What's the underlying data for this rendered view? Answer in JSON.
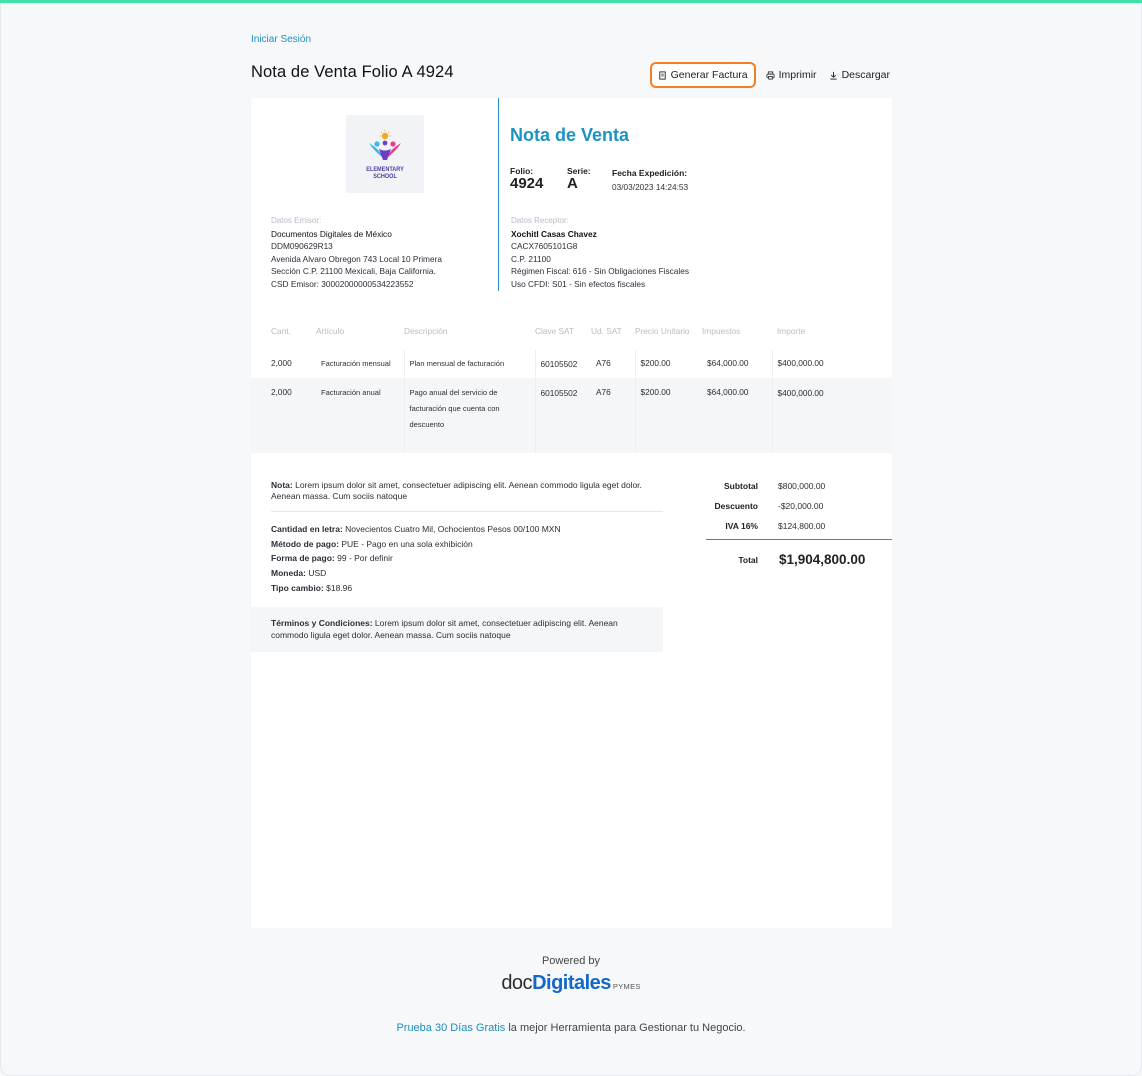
{
  "header": {
    "login_link": "Iniciar Sesión",
    "page_title": "Nota de Venta Folio A 4924",
    "actions": {
      "generate": "Generar Factura",
      "print": "Imprimir",
      "download": "Descargar"
    }
  },
  "document": {
    "logo_text_1": "ELEMENTARY",
    "logo_text_2": "SCHOOL",
    "heading": "Nota de Venta",
    "folio_label": "Folio:",
    "folio_value": "4924",
    "serie_label": "Serie:",
    "serie_value": "A",
    "fecha_label": "Fecha Expedición:",
    "fecha_value": "03/03/2023 14:24:53",
    "emisor": {
      "label": "Datos Emisor:",
      "name": "Documentos Digitales de México",
      "rfc": "DDM090629R13",
      "address_1": "Avenida Alvaro Obregon 743 Local 10 Primera",
      "address_2": "Sección C.P. 21100 Mexicali, Baja California.",
      "csd": "CSD Emisor: 30002000000534223552"
    },
    "receptor": {
      "label": "Datos Receptor:",
      "name": "Xochitl Casas Chavez",
      "rfc": "CACX7605101G8",
      "cp": "C.P. 21100",
      "regimen": "Régimen Fiscal: 616 - Sin Obligaciones Fiscales",
      "uso": "Uso CFDI: S01 - Sin efectos fiscales"
    },
    "table": {
      "headers": [
        "Cant.",
        "Artículo",
        "Descripción",
        "Clave SAT",
        "Ud. SAT",
        "Precio Unitario",
        "Impuestos",
        "Importe"
      ],
      "rows": [
        {
          "cant": "2,000",
          "articulo": "Facturación mensual",
          "descripcion": "Plan mensual de facturación",
          "clave": "60105502",
          "ud": "A76",
          "precio": "$200.00",
          "impuestos": "$64,000.00",
          "importe": "$400,000.00"
        },
        {
          "cant": "2,000",
          "articulo": "Facturación anual",
          "descripcion": "Pago anual del servicio de facturación que cuenta con descuento",
          "clave": "60105502",
          "ud": "A76",
          "precio": "$200.00",
          "impuestos": "$64,000.00",
          "importe": "$400,000.00"
        }
      ]
    },
    "nota_label": "Nota:",
    "nota_text": " Lorem ipsum dolor sit amet, consectetuer adipiscing elit. Aenean commodo ligula eget dolor. Aenean massa. Cum sociis natoque",
    "info": {
      "cantidad_label": "Cantidad en letra:",
      "cantidad_value": " Novecientos Cuatro Mil, Ochocientos Pesos 00/100 MXN",
      "metodo_label": "Método de pago:",
      "metodo_value": " PUE - Pago en una sola exhibición",
      "forma_label": "Forma de pago:",
      "forma_value": " 99 - Por definir",
      "moneda_label": "Moneda:",
      "moneda_value": " USD",
      "tipo_label": "Tipo cambio:",
      "tipo_value": " $18.96"
    },
    "terms_label": "Términos y Condiciones:",
    "terms_text": " Lorem ipsum dolor sit amet, consectetuer adipiscing elit. Aenean commodo ligula eget dolor. Aenean massa. Cum sociis natoque",
    "totals": {
      "subtotal_label": "Subtotal",
      "subtotal_value": "$800,000.00",
      "descuento_label": "Descuento",
      "descuento_value": "-$20,000.00",
      "iva_label": "IVA 16%",
      "iva_value": "$124,800.00",
      "total_label": "Total",
      "total_value": "$1,904,800.00"
    }
  },
  "footer": {
    "powered_by": "Powered by",
    "brand_a": "doc",
    "brand_b": "Digitales",
    "brand_c": "PYMES",
    "promo_link": "Prueba 30 Días Gratis",
    "promo_text": " la mejor Herramienta para Gestionar tu Negocio."
  },
  "colors": {
    "accent": "#1c93c3",
    "highlight_border": "#f07f26",
    "top_bar": "#3ee3a8",
    "brand_blue": "#1468c8"
  }
}
